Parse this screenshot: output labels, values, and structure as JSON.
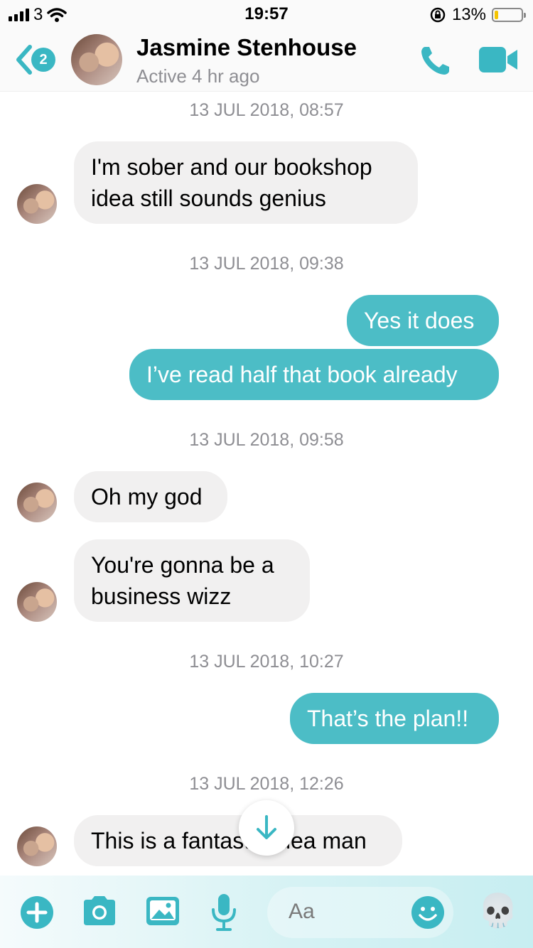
{
  "status_bar": {
    "carrier": "3",
    "time": "19:57",
    "battery_percent": "13%",
    "battery_level": 0.13
  },
  "header": {
    "back_badge_count": "2",
    "contact_name": "Jasmine Stenhouse",
    "active_status": "Active 4 hr ago",
    "icons": [
      "back-chevron-icon",
      "avatar",
      "phone-icon",
      "video-camera-icon"
    ]
  },
  "conversation": {
    "timestamps": [
      "13 JUL 2018, 08:57",
      "13 JUL 2018, 09:38",
      "13 JUL 2018, 09:58",
      "13 JUL 2018, 10:27",
      "13 JUL 2018, 12:26"
    ],
    "messages": [
      {
        "from": "them",
        "lines": [
          "I'm sober and our bookshop",
          "idea still sounds genius"
        ]
      },
      {
        "from": "me",
        "lines": [
          "Yes it does"
        ]
      },
      {
        "from": "me",
        "lines": [
          "I’ve read half that book already"
        ]
      },
      {
        "from": "them",
        "lines": [
          "Oh my god"
        ]
      },
      {
        "from": "them",
        "lines": [
          "You're gonna be a",
          "business wizz"
        ]
      },
      {
        "from": "me",
        "lines": [
          "That’s the plan!!"
        ]
      },
      {
        "from": "them",
        "lines": [
          "This is a fantastic idea man"
        ]
      }
    ],
    "last_message_visible": [
      "This is a fanta",
      "dea man"
    ]
  },
  "composer": {
    "placeholder": "Aa",
    "reaction_emoji": "💀",
    "icons": [
      "plus-icon",
      "camera-icon",
      "image-icon",
      "microphone-icon",
      "smiley-icon",
      "skull-emoji"
    ]
  },
  "colors": {
    "accent": "#3ab7c3",
    "outgoing_bubble": "#4cbdc6",
    "incoming_bubble": "#f1f0f0",
    "timestamp_text": "#8e8e93"
  }
}
